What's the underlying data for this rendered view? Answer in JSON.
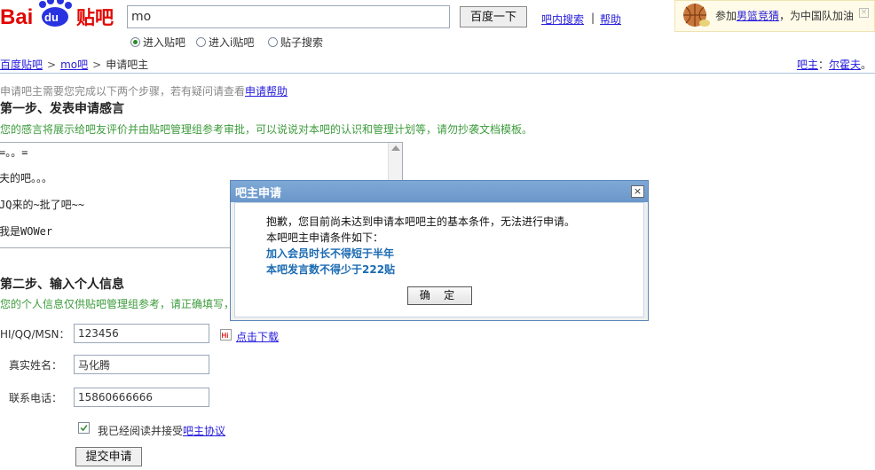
{
  "header": {
    "logo_text": "Bai du 贴吧",
    "search_value": "mo",
    "search_button": "百度一下",
    "in_bar_search": "吧内搜索",
    "separator": "|",
    "help": "帮助",
    "radios": [
      {
        "label": "进入贴吧",
        "checked": true
      },
      {
        "label": "进入i贴吧",
        "checked": false
      },
      {
        "label": "贴子搜索",
        "checked": false
      }
    ],
    "promo": {
      "prefix": "参加",
      "link": "男篮竞猜",
      "suffix": "，为中国队加油"
    }
  },
  "breadcrumb": {
    "items": [
      "百度贴吧",
      "mo吧",
      "申请吧主"
    ],
    "sep": ">"
  },
  "bar_owner": {
    "label": "吧主",
    "colon": "：",
    "name": "尔霍夫"
  },
  "intro": {
    "text": "申请吧主需要您完成以下两个步骤，若有疑问请查看",
    "link": "申请帮助"
  },
  "step1": {
    "title": "第一步、发表申请感言",
    "desc": "您的感言将展示给吧友评价并由贴吧管理组参考审批，可以说说对本吧的认识和管理计划等，请勿抄袭文档模板。",
    "lines": [
      "=。。=",
      "夫的吧。。。",
      "JQ来的~批了吧~~",
      "我是WOWer"
    ]
  },
  "step2": {
    "title": "第二步、输入个人信息",
    "desc": "您的个人信息仅供贴吧管理组参考，请正确填写，",
    "fields": [
      {
        "label": "HI/QQ/MSN：",
        "value": "123456"
      },
      {
        "label": "真实姓名：",
        "value": "马化腾"
      },
      {
        "label": "联系电话：",
        "value": "15860666666"
      }
    ],
    "download": "点击下载",
    "agree_text": "我已经阅读并接受",
    "agree_link": "吧主协议",
    "submit": "提交申请"
  },
  "dialog": {
    "title": "吧主申请",
    "close": "×",
    "message": "抱歉，您目前尚未达到申请本吧吧主的基本条件，无法进行申请。",
    "conditions_header": "本吧吧主申请条件如下：",
    "conditions": [
      "加入会员时长不得短于半年",
      "本吧发言数不得少于222贴"
    ],
    "ok": "确 定"
  },
  "colors": {
    "link": "#261cdc",
    "green_text": "#3c9b3c",
    "dialog_title": "#6b97c9",
    "condition": "#1b6bb3"
  }
}
